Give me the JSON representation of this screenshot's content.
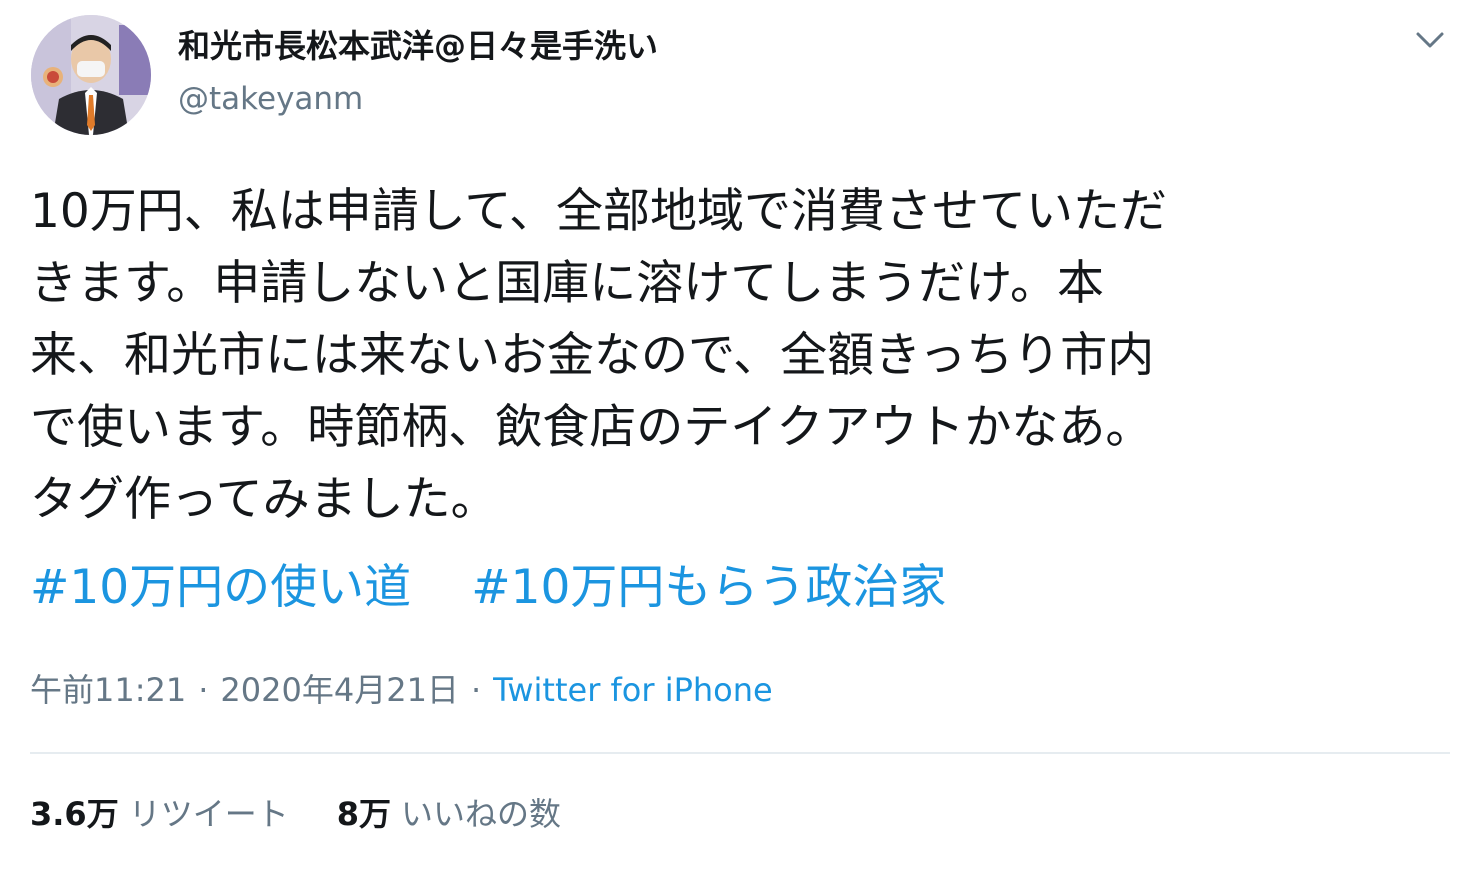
{
  "user": {
    "display_name": "和光市長松本武洋@日々是手洗い",
    "handle": "@takeyanm",
    "avatar_icon": "profile-photo"
  },
  "menu": {
    "icon": "chevron-down-icon"
  },
  "tweet": {
    "lines": [
      "10万円、私は申請して、全部地域で消費させていただ",
      "きます。申請しないと国庫に溶けてしまうだけ。本",
      "来、和光市には来ないお金なので、全額きっちり市内",
      "で使います。時節柄、飲食店のテイクアウトかなあ。",
      "タグ作ってみました。"
    ],
    "hashtags": [
      "#10万円の使い道",
      "#10万円もらう政治家"
    ]
  },
  "meta": {
    "time": "午前11:21",
    "separator": "·",
    "date": "2020年4月21日",
    "source": "Twitter for iPhone"
  },
  "stats": {
    "retweets_count": "3.6万",
    "retweets_label": "リツイート",
    "likes_count": "8万",
    "likes_label": "いいねの数"
  },
  "colors": {
    "text": "#14171a",
    "secondary": "#657786",
    "link": "#1b95e0",
    "divider": "#e6ecf0"
  }
}
